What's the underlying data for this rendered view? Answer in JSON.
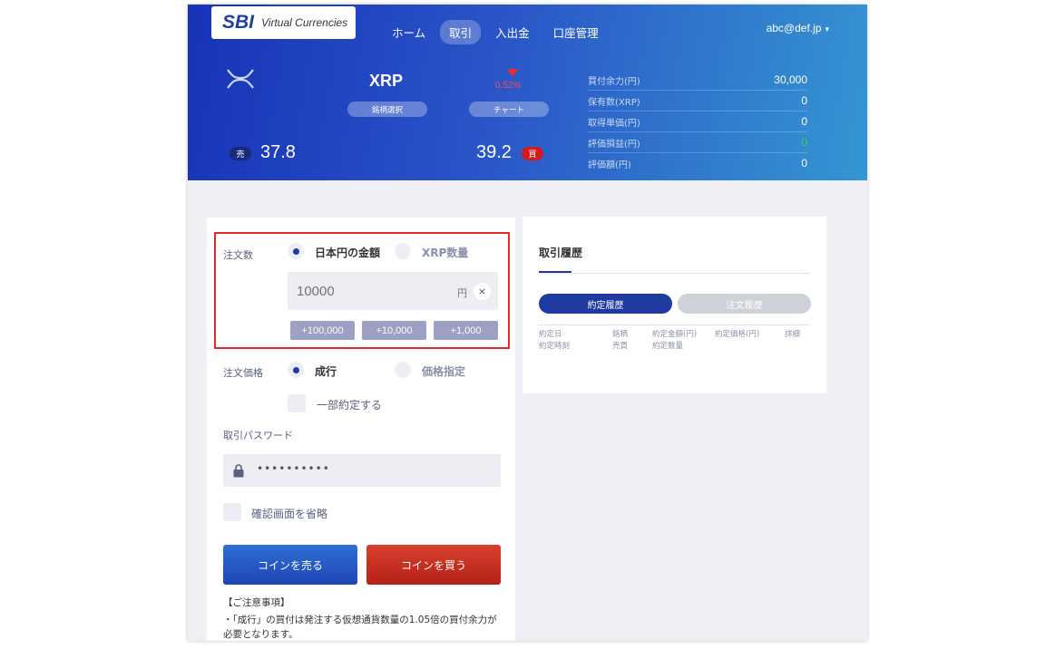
{
  "header": {
    "logo": {
      "brand": "SBI",
      "product": "Virtual Currencies"
    },
    "nav": [
      {
        "label": "ホーム",
        "active": false
      },
      {
        "label": "取引",
        "active": true
      },
      {
        "label": "入出金",
        "active": false
      },
      {
        "label": "口座管理",
        "active": false
      }
    ],
    "user": {
      "email": "abc@def.jp",
      "caret": "▾"
    }
  },
  "coin": {
    "name": "XRP",
    "select_label": "銘柄選択",
    "chart_label": "チャート",
    "change": "0.52%",
    "change_direction": "down",
    "sell_badge": "売",
    "sell_price": "37.8",
    "buy_badge": "買",
    "buy_price": "39.2"
  },
  "account": [
    {
      "label": "買付余力(円)",
      "value": "30,000"
    },
    {
      "label": "保有数(XRP)",
      "value": "0"
    },
    {
      "label": "取得単価(円)",
      "value": "0"
    },
    {
      "label": "評価損益(円)",
      "value": "0",
      "color": "#3bd64a"
    },
    {
      "label": "評価額(円)",
      "value": "0"
    }
  ],
  "order": {
    "qty_label": "注文数",
    "qty_options": [
      {
        "label": "日本円の金額",
        "selected": true
      },
      {
        "label": "XRP数量",
        "selected": false
      }
    ],
    "amount_value": "",
    "amount_placeholder": "10000",
    "yen_unit": "円",
    "clear": "×",
    "quick_buttons": [
      "+100,000",
      "+10,000",
      "+1,000"
    ],
    "price_label": "注文価格",
    "price_options": [
      {
        "label": "成行",
        "selected": true
      },
      {
        "label": "価格指定",
        "selected": false
      }
    ],
    "partial_label": "一部約定する",
    "password_label": "取引パスワード",
    "password_dots": "••••••••••",
    "skip_confirm_label": "確認画面を省略",
    "sell_button": "コインを売る",
    "buy_button": "コインを買う",
    "notice_title": "【ご注意事項】",
    "notice_text": "・「成行」の買付は発注する仮想通貨数量の1.05倍の買付余力が必要となります。"
  },
  "history": {
    "title": "取引履歴",
    "tabs": [
      {
        "label": "約定履歴",
        "active": true
      },
      {
        "label": "注文履歴",
        "active": false
      }
    ],
    "columns": [
      {
        "line1": "約定日",
        "line2": "約定時刻"
      },
      {
        "line1": "銘柄",
        "line2": "売買"
      },
      {
        "line1": "約定金額(円)",
        "line2": "約定数量"
      },
      {
        "line1": "約定価格(円)",
        "line2": ""
      },
      {
        "line1": "詳細",
        "line2": ""
      }
    ]
  },
  "colors": {
    "brand_blue": "#1f3aa0",
    "sell_blue": "#1f45b5",
    "buy_red": "#b52218",
    "highlight_red": "#e5262b",
    "profit_green": "#3bd64a"
  }
}
